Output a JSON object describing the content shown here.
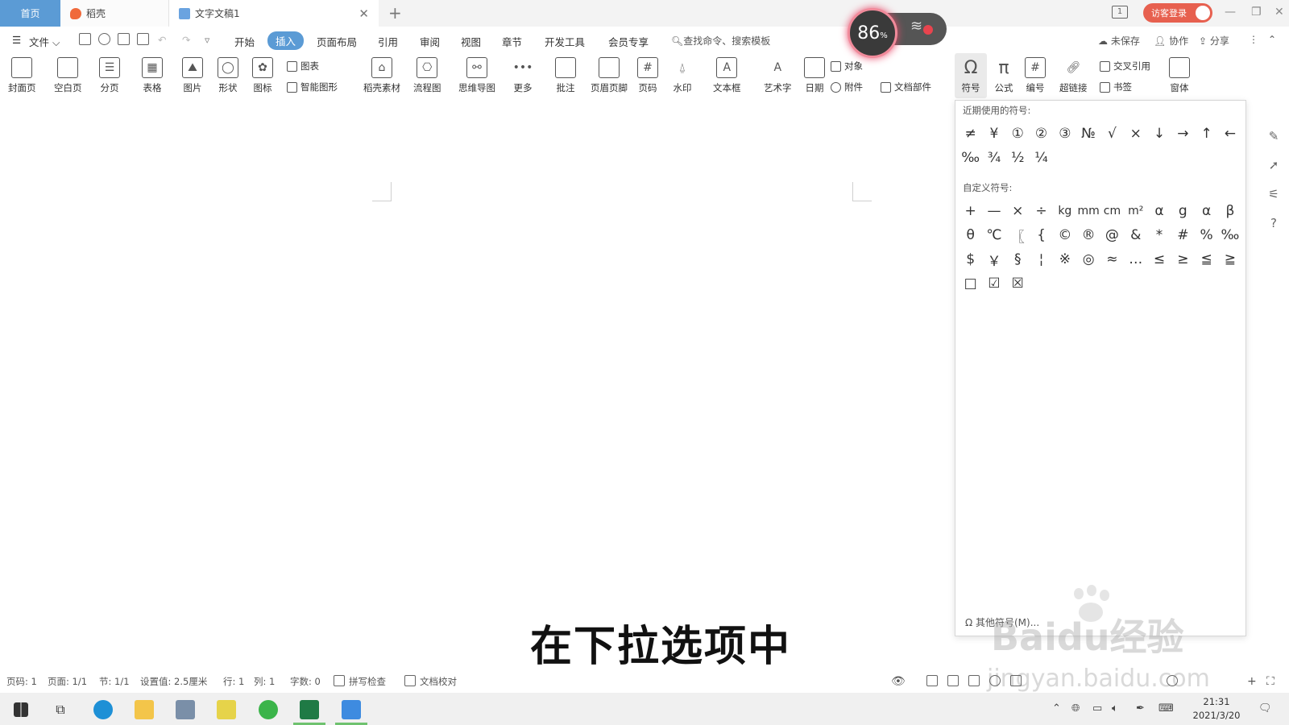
{
  "tabs": {
    "home": "首页",
    "daoke": "稻壳",
    "doc": "文字文稿1"
  },
  "title_bar": {
    "login": "访客登录",
    "tab_count": "1"
  },
  "net_widget": {
    "percent": "86",
    "unit": "%"
  },
  "menu": {
    "file": "文件",
    "items": [
      "开始",
      "插入",
      "页面布局",
      "引用",
      "审阅",
      "视图",
      "章节",
      "开发工具",
      "会员专享"
    ],
    "search": "查找命令、搜索模板",
    "unsaved": "未保存",
    "collab": "协作",
    "share": "分享"
  },
  "ribbon": {
    "cover": "封面页",
    "blank": "空白页",
    "pagebreak": "分页",
    "table": "表格",
    "picture": "图片",
    "shape": "形状",
    "icon": "图标",
    "chart": "图表",
    "smartart": "智能图形",
    "daoke_material": "稻壳素材",
    "flowchart": "流程图",
    "mindmap": "思维导图",
    "more": "更多",
    "comment": "批注",
    "header_footer": "页眉页脚",
    "page_number": "页码",
    "watermark": "水印",
    "textbox": "文本框",
    "wordart": "艺术字",
    "date": "日期",
    "object": "对象",
    "attachment": "附件",
    "doc_parts": "文档部件",
    "symbol": "符号",
    "formula": "公式",
    "numbering": "编号",
    "hyperlink": "超链接",
    "cross_ref": "交叉引用",
    "bookmark": "书签",
    "window": "窗体"
  },
  "symbols": {
    "recent_title": "近期使用的符号:",
    "recent": [
      "≠",
      "¥",
      "①",
      "②",
      "③",
      "№",
      "√",
      "×",
      "↓",
      "→",
      "↑",
      "←",
      "‰",
      "¾",
      "½",
      "¼"
    ],
    "custom_title": "自定义符号:",
    "custom": [
      "+",
      "—",
      "×",
      "÷",
      "kg",
      "mm",
      "cm",
      "m²",
      "α",
      "g",
      "α",
      "β",
      "θ",
      "℃",
      "〖",
      "{",
      "©",
      "®",
      "@",
      "&",
      "*",
      "#",
      "%",
      "‰",
      "$",
      "￥",
      "§",
      "¦",
      "※",
      "◎",
      "≈",
      "…",
      "≤",
      "≥",
      "≦",
      "≧",
      "□",
      "☑",
      "☒"
    ],
    "more": "其他符号(M)..."
  },
  "subtitle": "在下拉选项中",
  "watermark": {
    "logo": "Baidu经验",
    "url": "jingyan.baidu.com"
  },
  "status": {
    "page": "页码: 1",
    "pages": "页面: 1/1",
    "section": "节: 1/1",
    "setting": "设置值: 2.5厘米",
    "row": "行: 1",
    "col": "列: 1",
    "words": "字数: 0",
    "spellcheck": "拼写检查",
    "proofread": "文档校对"
  },
  "taskbar": {
    "time": "21:31",
    "date": "2021/3/20"
  }
}
